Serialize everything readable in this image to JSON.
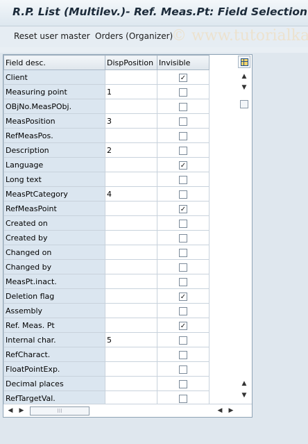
{
  "window": {
    "title": "R.P. List (Multilev.)- Ref. Meas.Pt: Field Selection"
  },
  "toolbar": {
    "reset_label": "Reset user master",
    "orders_label": "Orders (Organizer)",
    "watermark": "© www.tutorialka"
  },
  "grid": {
    "columns": [
      "Field desc.",
      "DispPosition",
      "Invisible"
    ],
    "rows": [
      {
        "desc": "Client",
        "disp": "",
        "invisible": true
      },
      {
        "desc": "Measuring point",
        "disp": "1",
        "invisible": false
      },
      {
        "desc": "OBjNo.MeasPObj.",
        "disp": "",
        "invisible": false
      },
      {
        "desc": "MeasPosition",
        "disp": "3",
        "invisible": false
      },
      {
        "desc": "RefMeasPos.",
        "disp": "",
        "invisible": false
      },
      {
        "desc": "Description",
        "disp": "2",
        "invisible": false
      },
      {
        "desc": "Language",
        "disp": "",
        "invisible": true
      },
      {
        "desc": "Long text",
        "disp": "",
        "invisible": false
      },
      {
        "desc": "MeasPtCategory",
        "disp": "4",
        "invisible": false
      },
      {
        "desc": "RefMeasPoint",
        "disp": "",
        "invisible": true
      },
      {
        "desc": "Created on",
        "disp": "",
        "invisible": false
      },
      {
        "desc": "Created by",
        "disp": "",
        "invisible": false
      },
      {
        "desc": "Changed on",
        "disp": "",
        "invisible": false
      },
      {
        "desc": "Changed by",
        "disp": "",
        "invisible": false
      },
      {
        "desc": "MeasPt.inact.",
        "disp": "",
        "invisible": false
      },
      {
        "desc": "Deletion flag",
        "disp": "",
        "invisible": true
      },
      {
        "desc": "Assembly",
        "disp": "",
        "invisible": false
      },
      {
        "desc": "Ref. Meas. Pt",
        "disp": "",
        "invisible": true
      },
      {
        "desc": "Internal char.",
        "disp": "5",
        "invisible": false
      },
      {
        "desc": "RefCharact.",
        "disp": "",
        "invisible": false
      },
      {
        "desc": "FloatPointExp.",
        "disp": "",
        "invisible": false
      },
      {
        "desc": "Decimal places",
        "disp": "",
        "invisible": false
      },
      {
        "desc": "RefTargetVal.",
        "disp": "",
        "invisible": false
      }
    ]
  }
}
